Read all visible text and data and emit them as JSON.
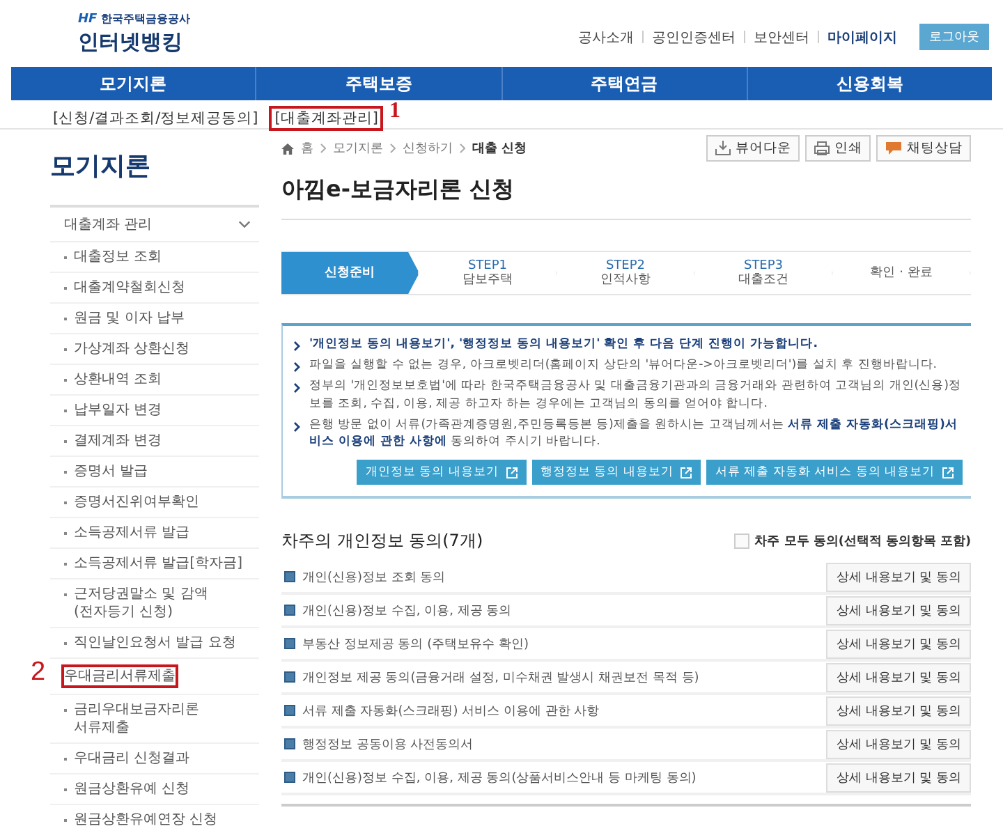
{
  "header": {
    "logo_mark": "HF",
    "logo_org": "한국주택금융공사",
    "logo_title": "인터넷뱅킹",
    "top_links": [
      "공사소개",
      "공인인증센터",
      "보안센터",
      "마이페이지"
    ],
    "logout": "로그아웃"
  },
  "nav": [
    "모기지론",
    "주택보증",
    "주택연금",
    "신용회복"
  ],
  "subnav": [
    {
      "label": "[신청/결과조회/정보제공동의]"
    },
    {
      "label": "[대출계좌관리]",
      "annotation": "1"
    }
  ],
  "sidebar": {
    "title": "모기지론",
    "group": {
      "label": "대출계좌 관리",
      "expanded": true
    },
    "items": [
      {
        "label": "대출정보 조회"
      },
      {
        "label": "대출계약철회신청"
      },
      {
        "label": "원금 및 이자 납부"
      },
      {
        "label": "가상계좌 상환신청"
      },
      {
        "label": "상환내역 조회"
      },
      {
        "label": "납부일자 변경"
      },
      {
        "label": "결제계좌 변경"
      },
      {
        "label": "증명서 발급"
      },
      {
        "label": "증명서진위여부확인"
      },
      {
        "label": "소득공제서류 발급"
      },
      {
        "label": "소득공제서류 발급[학자금]"
      },
      {
        "label": "근저당권말소 및 감액\n(전자등기 신청)"
      },
      {
        "label": "직인날인요청서 발급 요청"
      },
      {
        "label": "우대금리서류제출",
        "annotation": "2"
      },
      {
        "label": "금리우대보금자리론\n서류제출"
      },
      {
        "label": "우대금리 신청결과"
      },
      {
        "label": "원금상환유예 신청"
      },
      {
        "label": "원금상환유예연장 신청"
      }
    ]
  },
  "breadcrumb": [
    "홈",
    "모기지론",
    "신청하기",
    "대출 신청"
  ],
  "tools": [
    {
      "kind": "download",
      "label": "뷰어다운"
    },
    {
      "kind": "print",
      "label": "인쇄"
    },
    {
      "kind": "chat",
      "label": "채팅상담"
    }
  ],
  "page_title": "아낌e-보금자리론 신청",
  "steps": [
    {
      "label": "신청준비",
      "selected": true
    },
    {
      "step": "STEP1",
      "label": "담보주택",
      "selected": false
    },
    {
      "step": "STEP2",
      "label": "인적사항",
      "selected": false
    },
    {
      "step": "STEP3",
      "label": "대출조건",
      "selected": false
    },
    {
      "label": "확인 · 완료",
      "selected": false
    }
  ],
  "notes": [
    {
      "text": "'개인정보 동의 내용보기', '행정정보 동의 내용보기' 확인 후 다음 단계 진행이 가능합니다.",
      "bold": true
    },
    {
      "text": "파일을 실행할 수 없는 경우, 아크로벳리더(홈페이지 상단의 '뷰어다운->아크로벳리더')를 설치 후 진행바랍니다.",
      "bold": false
    },
    {
      "text": "정부의 '개인정보보호법'에 따라 한국주택금융공사 및 대출금융기관과의 금융거래와 관련하여 고객님의 개인(신용)정보를 조회, 수집, 이용, 제공 하고자 하는 경우에는 고객님의 동의를 얻어야 합니다.",
      "bold": false
    },
    {
      "text": "은행 방문 없이 서류(가족관계증명원,주민등록등본 등)제출을 원하시는 고객님께서는 **서류 제출 자동화(스크래핑)서비스 이용에 관한 사항에** 동의하여 주시기 바랍니다.",
      "bold": false
    }
  ],
  "note_buttons": [
    "개인정보 동의 내용보기",
    "행정정보 동의 내용보기",
    "서류 제출 자동화 서비스 동의 내용보기"
  ],
  "consent": {
    "title": "차주의 개인정보 동의(7개)",
    "all_agree": {
      "label": "차주 모두 동의(선택적 동의항목 포함)",
      "checked": false
    },
    "rows": [
      {
        "label": "개인(신용)정보 조회 동의",
        "button": "상세 내용보기 및 동의"
      },
      {
        "label": "개인(신용)정보 수집, 이용, 제공 동의",
        "button": "상세 내용보기 및 동의"
      },
      {
        "label": "부동산 정보제공 동의 (주택보유수 확인)",
        "button": "상세 내용보기 및 동의"
      },
      {
        "label": "개인정보 제공 동의(금융거래 설정, 미수채권 발생시 채권보전 목적 등)",
        "button": "상세 내용보기 및 동의"
      },
      {
        "label": "서류 제출 자동화(스크래핑) 서비스 이용에 관한 사항",
        "button": "상세 내용보기 및 동의"
      },
      {
        "label": "행정정보 공동이용 사전동의서",
        "button": "상세 내용보기 및 동의"
      },
      {
        "label": "개인(신용)정보 수집, 이용, 제공 동의(상품서비스안내 등 마케팅 동의)",
        "button": "상세 내용보기 및 동의"
      }
    ]
  }
}
